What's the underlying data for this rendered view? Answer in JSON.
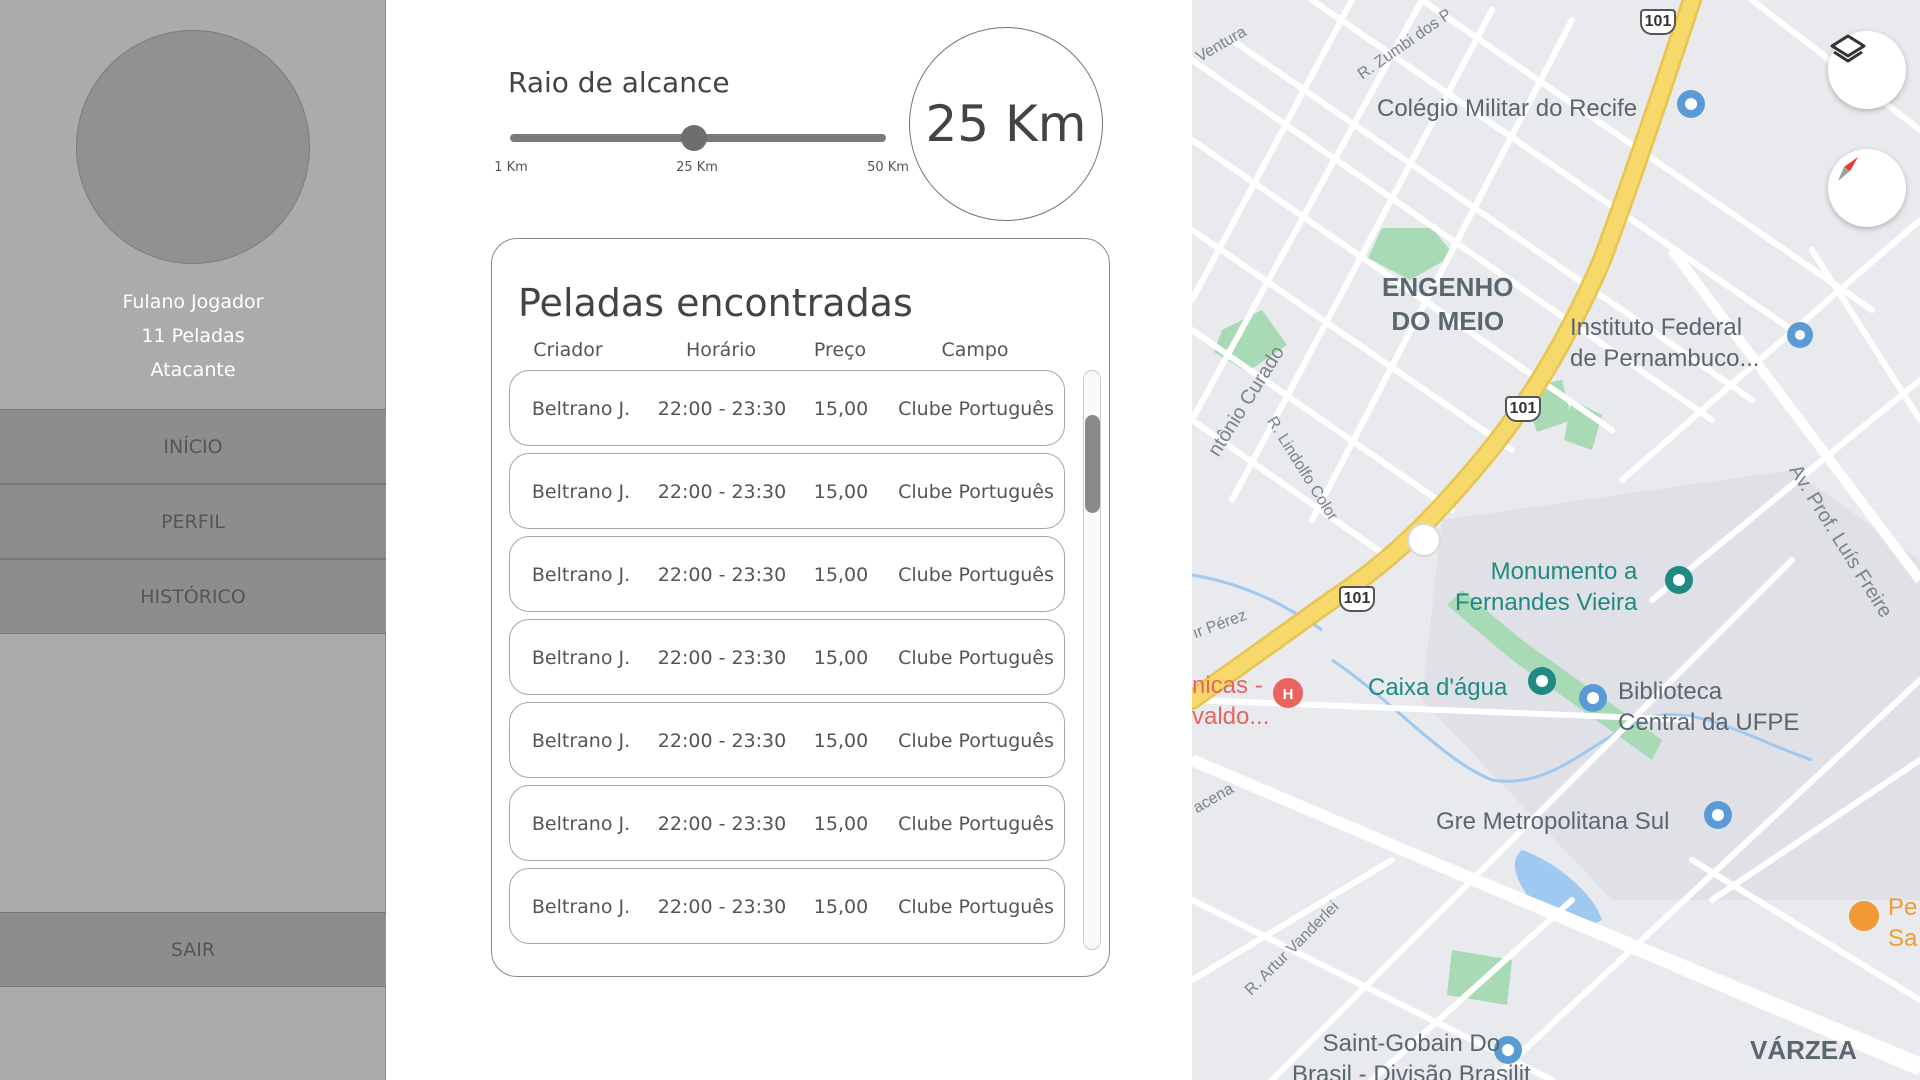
{
  "sidebar": {
    "user_name": "Fulano Jogador",
    "games_count": "11 Peladas",
    "position": "Atacante",
    "nav": {
      "inicio": "INÍCIO",
      "perfil": "PERFIL",
      "historico": "HISTÓRICO"
    },
    "logout": "SAIR"
  },
  "range": {
    "title": "Raio de alcance",
    "value_label": "25 Km",
    "value_km": 25,
    "min_km": 1,
    "max_km": 50,
    "ticks": {
      "min": "1 Km",
      "mid": "25 Km",
      "max": "50 Km"
    }
  },
  "results": {
    "title": "Peladas encontradas",
    "columns": {
      "criador": "Criador",
      "horario": "Horário",
      "preco": "Preço",
      "campo": "Campo"
    },
    "rows": [
      {
        "criador": "Beltrano J.",
        "horario": "22:00 - 23:30",
        "preco": "15,00",
        "campo": "Clube Português"
      },
      {
        "criador": "Beltrano J.",
        "horario": "22:00 - 23:30",
        "preco": "15,00",
        "campo": "Clube Português"
      },
      {
        "criador": "Beltrano J.",
        "horario": "22:00 - 23:30",
        "preco": "15,00",
        "campo": "Clube Português"
      },
      {
        "criador": "Beltrano J.",
        "horario": "22:00 - 23:30",
        "preco": "15,00",
        "campo": "Clube Português"
      },
      {
        "criador": "Beltrano J.",
        "horario": "22:00 - 23:30",
        "preco": "15,00",
        "campo": "Clube Português"
      },
      {
        "criador": "Beltrano J.",
        "horario": "22:00 - 23:30",
        "preco": "15,00",
        "campo": "Clube Português"
      },
      {
        "criador": "Beltrano J.",
        "horario": "22:00 - 23:30",
        "preco": "15,00",
        "campo": "Clube Português"
      }
    ]
  },
  "map": {
    "places": {
      "colegio_militar": "Colégio Militar do Recife",
      "engenho_line1": "ENGENHO",
      "engenho_line2": "DO MEIO",
      "instituto_line1": "Instituto Federal",
      "instituto_line2": "de Pernambuco...",
      "monumento_line1": "Monumento a",
      "monumento_line2": "Fernandes Vieira",
      "caixa_dagua": "Caixa d'água",
      "biblioteca_line1": "Biblioteca",
      "biblioteca_line2": "Central da UFPE",
      "gre": "Gre Metropolitana Sul",
      "saint_gobain_line1": "Saint-Gobain Do",
      "saint_gobain_line2": "Brasil - Divisão Brasilit",
      "varzea": "VÁRZEA",
      "hospital_line1": "nicas -",
      "hospital_line2": "valdo...",
      "restaurant_line1": "Pe",
      "restaurant_line2": "Sa"
    },
    "streets": {
      "ventura": "Ventura",
      "zumbi": "R. Zumbi dos P",
      "antonio_curado": "ntônio Curado",
      "lindolfo": "R. Lindolfo Color",
      "perez": "ır Pérez",
      "luis_freire": "Av. Prof. Luís Freire",
      "acena": "acena",
      "artur": "R. Artur Vanderlei"
    },
    "route_shields": [
      "101",
      "101",
      "101"
    ],
    "colors": {
      "highway": "#f6d86b",
      "road": "#ffffff",
      "park": "#a8dab5",
      "water": "#9fc9f0",
      "poi_teal": "#1f8a83",
      "poi_red": "#e8645d",
      "poi_orange": "#f19a37"
    }
  }
}
